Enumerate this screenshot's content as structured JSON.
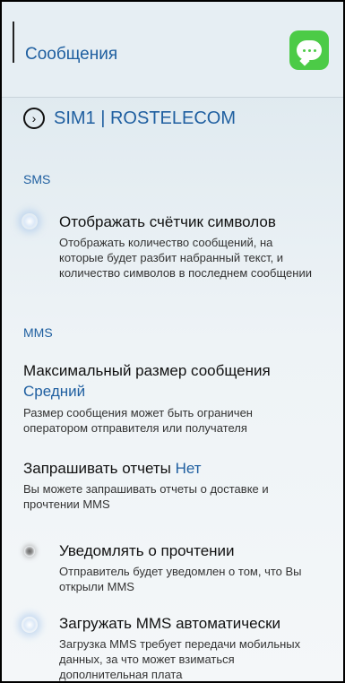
{
  "header": {
    "title": "Сообщения",
    "app_icon": "messages-icon"
  },
  "sim": {
    "label": "SIM1 | ROSTELECOM",
    "icon": "chevron-right-circle-icon"
  },
  "sections": {
    "sms": "SMS",
    "mms": "MMS"
  },
  "items": {
    "char_counter": {
      "title": "Отображать счётчик символов",
      "desc": "Отображать количество сообщений, на которые будет разбит набранный текст, и количество символов в последнем сообщении",
      "enabled": true
    },
    "max_size": {
      "title": "Максимальный размер сообщения",
      "value": "Средний",
      "desc": "Размер сообщения может быть ограничен оператором отправителя или получателя"
    },
    "request_reports": {
      "title": "Запрашивать отчеты",
      "value": "Нет",
      "desc": "Вы можете запрашивать отчеты о доставке и прочтении MMS"
    },
    "read_notify": {
      "title": "Уведомлять о прочтении",
      "desc": "Отправитель будет уведомлен о том, что Вы открыли MMS",
      "enabled": false
    },
    "auto_download": {
      "title": "Загружать MMS автоматически",
      "desc": "Загрузка MMS требует передачи мобильных данных, за что может взиматься дополнительная плата",
      "enabled": true
    }
  }
}
